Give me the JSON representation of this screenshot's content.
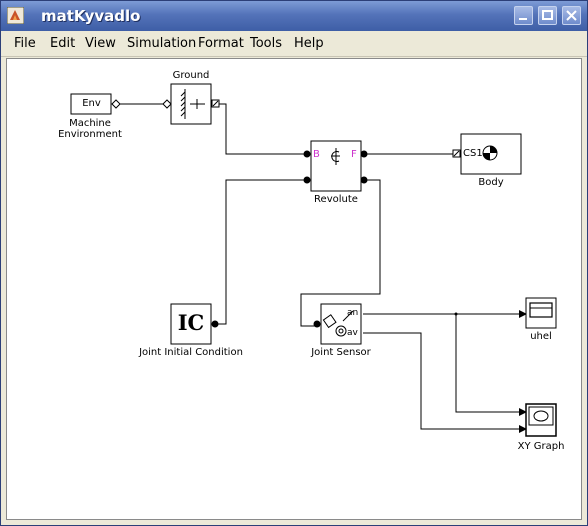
{
  "window": {
    "title": "matKyvadlo"
  },
  "menu": [
    "File",
    "Edit",
    "View",
    "Simulation",
    "Format",
    "Tools",
    "Help"
  ],
  "blocks": {
    "env": {
      "text": "Env",
      "label_line1": "Machine",
      "label_line2": "Environment"
    },
    "ground": {
      "label": "Ground"
    },
    "revolute": {
      "label": "Revolute",
      "port_b": "B",
      "port_f": "F"
    },
    "body": {
      "label": "Body",
      "text": "CS1"
    },
    "ic": {
      "text": "IC",
      "label": "Joint Initial Condition"
    },
    "sensor": {
      "label": "Joint Sensor",
      "port_an": "an",
      "port_av": "av"
    },
    "uhel": {
      "label": "uhel"
    },
    "xy": {
      "label": "XY Graph"
    }
  },
  "colors": {
    "titlebar": "#4a6bb3",
    "port_label": "#cc33cc",
    "canvas": "#ffffff"
  }
}
